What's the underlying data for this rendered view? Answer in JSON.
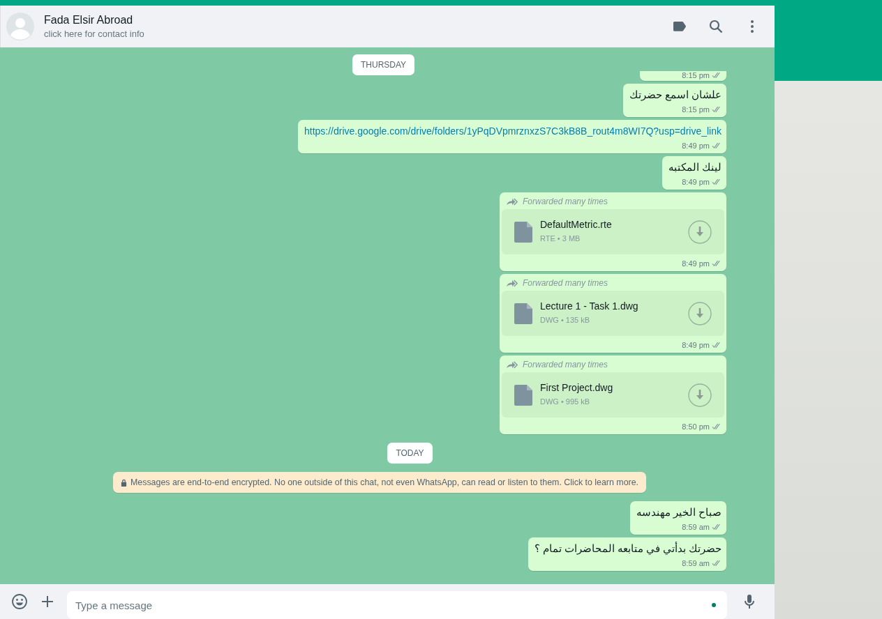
{
  "header": {
    "name": "Fada Elsir Abroad",
    "subtitle": "click here for contact info"
  },
  "sticky_date": "THURSDAY",
  "messages": [
    {
      "kind": "cut",
      "time": "8:15 pm"
    },
    {
      "kind": "text",
      "text": "علشان اسمع حضرتك",
      "time": "8:15 pm"
    },
    {
      "kind": "link",
      "text": "https://drive.google.com/drive/folders/1yPqDVpmrznxzS7C3kB8B_rout4m8WI7Q?usp=drive_link",
      "time": "8:49 pm"
    },
    {
      "kind": "text",
      "text": "لينك المكتبه",
      "time": "8:49 pm"
    },
    {
      "kind": "file",
      "forwarded": "Forwarded many times",
      "name": "DefaultMetric.rte",
      "meta": "RTE • 3 MB",
      "time": "8:49 pm"
    },
    {
      "kind": "file",
      "forwarded": "Forwarded many times",
      "name": "Lecture 1 - Task 1.dwg",
      "meta": "DWG • 135 kB",
      "time": "8:49 pm"
    },
    {
      "kind": "file",
      "forwarded": "Forwarded many times",
      "name": "First Project.dwg",
      "meta": "DWG • 995 kB",
      "time": "8:50 pm"
    },
    {
      "kind": "date",
      "text": "TODAY"
    },
    {
      "kind": "system",
      "text": "Messages are end-to-end encrypted. No one outside of this chat, not even WhatsApp, can read or listen to them. Click to learn more."
    },
    {
      "kind": "text",
      "text": "صباح الخير مهندسه",
      "time": "8:59 am"
    },
    {
      "kind": "text",
      "text": "حضرتك بدأتي في متابعه المحاضرات تمام ؟",
      "time": "8:59 am"
    }
  ],
  "composer": {
    "placeholder": "Type a message"
  }
}
